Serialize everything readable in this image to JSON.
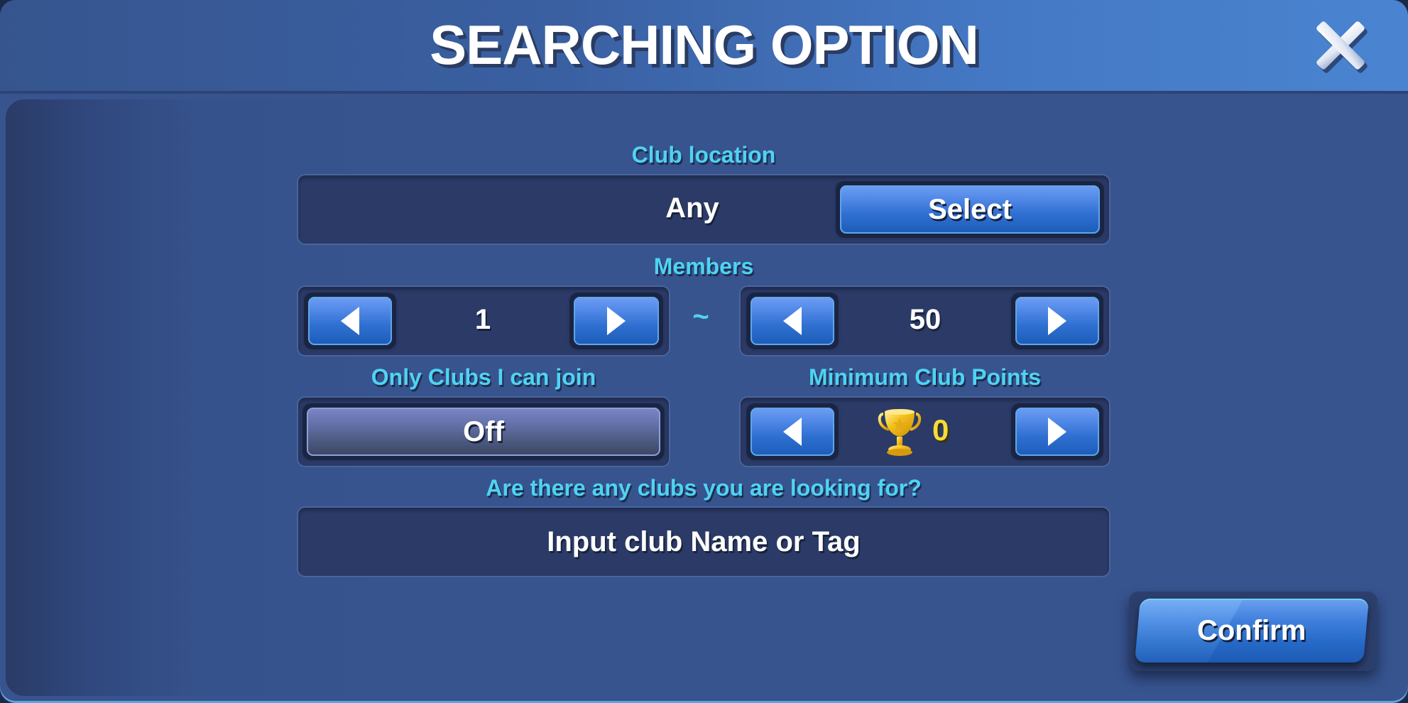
{
  "dialog": {
    "title": "SEARCHING OPTION",
    "close_icon": "close-icon"
  },
  "club_location": {
    "label": "Club location",
    "value": "Any",
    "select_label": "Select"
  },
  "members": {
    "label": "Members",
    "min_value": "1",
    "max_value": "50",
    "separator": "~",
    "decrease_icon": "triangle-left-icon",
    "increase_icon": "triangle-right-icon"
  },
  "only_joinable": {
    "label": "Only Clubs I can join",
    "value": "Off"
  },
  "min_points": {
    "label": "Minimum Club Points",
    "value": "0",
    "icon": "trophy-icon"
  },
  "search": {
    "label": "Are there any clubs you are looking for?",
    "placeholder": "Input club Name or Tag"
  },
  "footer": {
    "confirm_label": "Confirm"
  },
  "colors": {
    "accent_label": "#4fd3f2",
    "button_blue": "#2f6fd0",
    "panel_bg": "#37548f",
    "well_bg": "#2b3a66",
    "gold": "#f6dc3a"
  }
}
